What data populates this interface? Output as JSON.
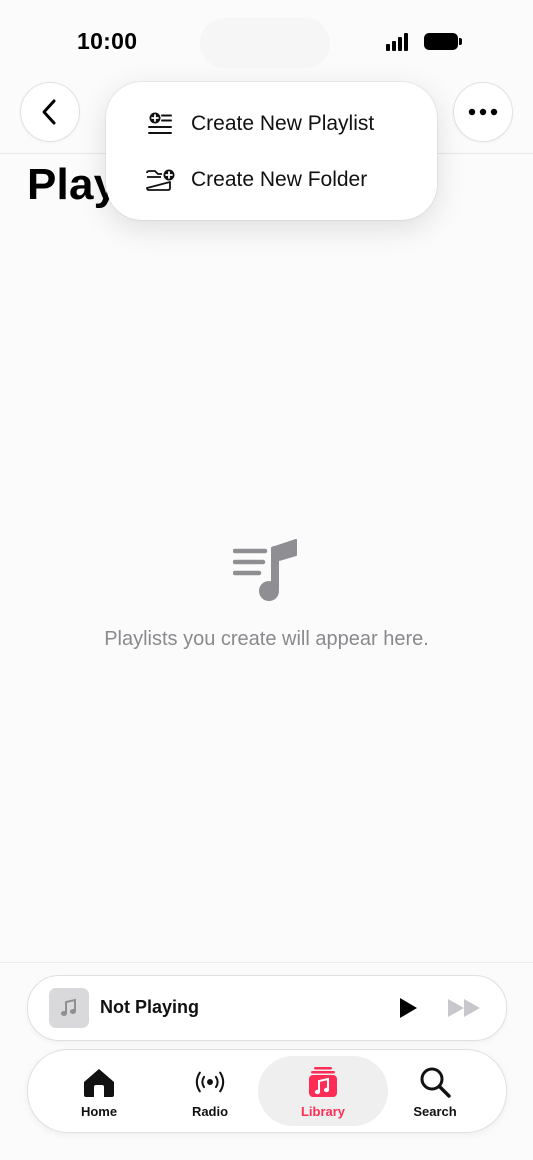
{
  "status_bar": {
    "time": "10:00"
  },
  "nav": {
    "title": "Playlists"
  },
  "menu": {
    "items": [
      {
        "label": "Create New Playlist",
        "icon": "add-playlist-icon"
      },
      {
        "label": "Create New Folder",
        "icon": "add-folder-icon"
      }
    ]
  },
  "empty_state": {
    "icon": "playlist-music-icon",
    "message": "Playlists you create will appear here."
  },
  "mini_player": {
    "title": "Not Playing"
  },
  "tabs": [
    {
      "label": "Home",
      "icon": "house-icon"
    },
    {
      "label": "Radio",
      "icon": "radio-waves-icon"
    },
    {
      "label": "Library",
      "icon": "music-library-icon",
      "selected": true
    },
    {
      "label": "Search",
      "icon": "magnifying-glass-icon"
    }
  ],
  "colors": {
    "accent": "#ff2d55",
    "secondary_text": "#8a8a8e",
    "background": "#fbfbfb"
  }
}
